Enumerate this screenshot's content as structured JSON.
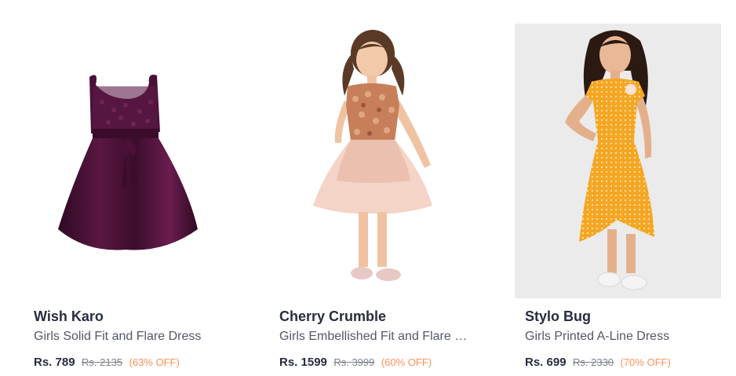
{
  "products": [
    {
      "brand": "Wish Karo",
      "title": "Girls Solid Fit and Flare Dress",
      "price": "Rs. 789",
      "mrp": "Rs. 2135",
      "discount": "(63% OFF)",
      "image_icon": "purple-dress-image"
    },
    {
      "brand": "Cherry Crumble",
      "title": "Girls Embellished Fit and Flare Dress",
      "price": "Rs. 1599",
      "mrp": "Rs. 3999",
      "discount": "(60% OFF)",
      "image_icon": "pink-sequin-dress-model-image"
    },
    {
      "brand": "Stylo Bug",
      "title": "Girls Printed A-Line Dress",
      "price": "Rs. 699",
      "mrp": "Rs. 2330",
      "discount": "(70% OFF)",
      "image_icon": "yellow-printed-dress-model-image"
    }
  ],
  "colors": {
    "brand_text": "#282c3f",
    "title_text": "#535766",
    "mrp_text": "#7e818c",
    "discount_text": "#ff905a"
  }
}
